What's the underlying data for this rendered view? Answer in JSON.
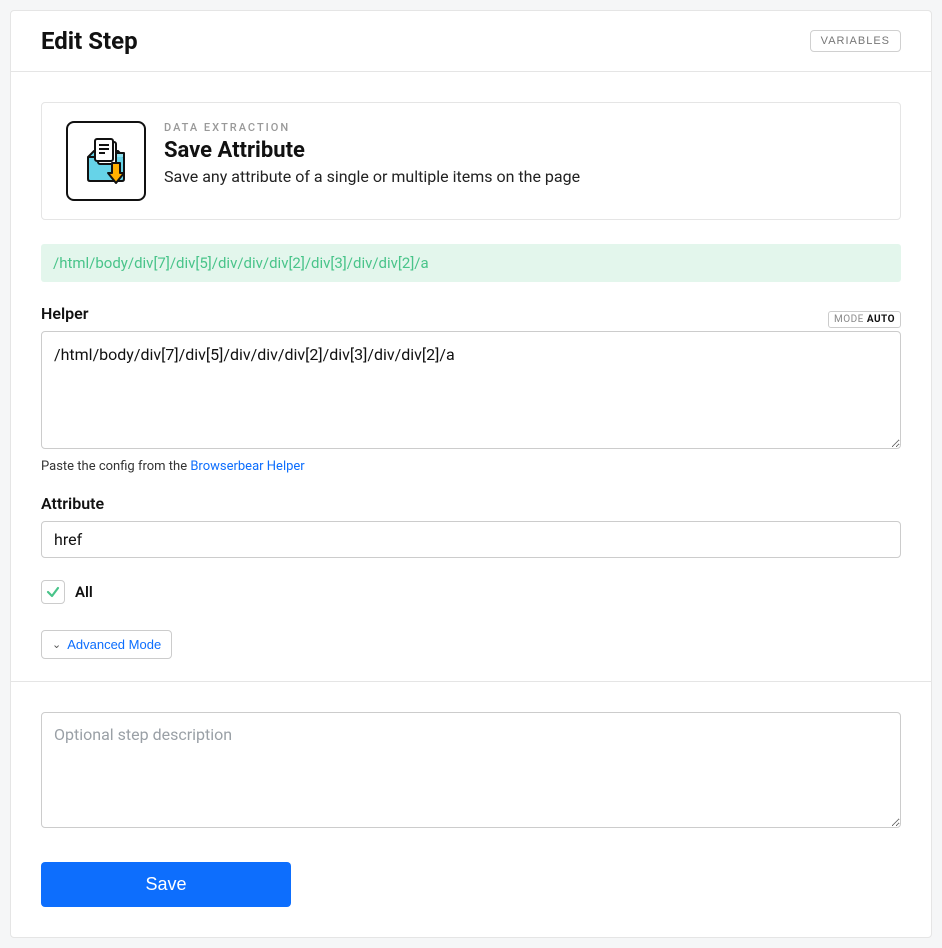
{
  "header": {
    "title": "Edit Step",
    "variables_button": "VARIABLES"
  },
  "step": {
    "category": "DATA EXTRACTION",
    "title": "Save Attribute",
    "description": "Save any attribute of a single or multiple items on the page"
  },
  "xpath_display": "/html/body/div[7]/div[5]/div/div/div[2]/div[3]/div/div[2]/a",
  "helper": {
    "label": "Helper",
    "mode_prefix": "MODE",
    "mode_value": "AUTO",
    "value": "/html/body/div[7]/div[5]/div/div/div[2]/div[3]/div/div[2]/a",
    "hint_prefix": "Paste the config from the ",
    "hint_link": "Browserbear Helper"
  },
  "attribute": {
    "label": "Attribute",
    "value": "href"
  },
  "all_checkbox": {
    "label": "All",
    "checked": true
  },
  "advanced_mode_label": "Advanced Mode",
  "description_input": {
    "placeholder": "Optional step description",
    "value": ""
  },
  "save_button": "Save"
}
